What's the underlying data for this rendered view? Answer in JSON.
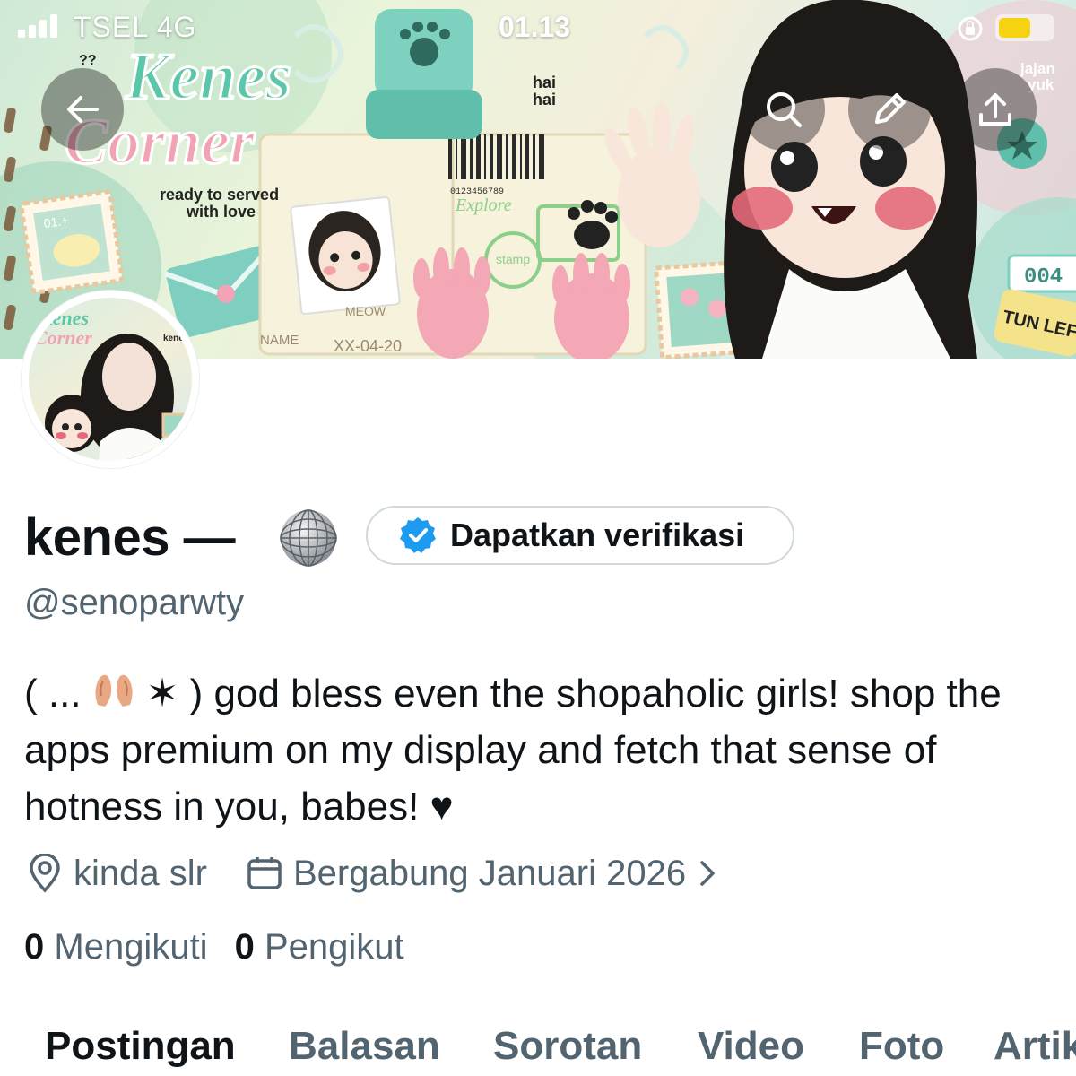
{
  "status_bar": {
    "carrier": "TSEL  4G",
    "time": "01.13",
    "battery_level": 0.6,
    "battery_color": "#f5d313"
  },
  "banner": {
    "texts": {
      "qq": "??",
      "title_line1": "Kenes",
      "title_line2": "Corner",
      "tagline_line1": "ready to served",
      "tagline_line2": "with love",
      "hai": "hai",
      "hai2": "hai",
      "jajan": "jajan",
      "yuk": "yuk",
      "stamp_no": "004",
      "stamp_text": "TUN LEFT",
      "card_num": "01.+",
      "explore": "Explore",
      "stamp": "stamp",
      "name_label": "NAME",
      "date_label": "XX-04-20",
      "meow": "MEOW",
      "barcode_num": "0123456789"
    },
    "buttons": {
      "back": "back-arrow-icon",
      "search": "search-icon",
      "edit": "pencil-icon",
      "share": "share-icon"
    }
  },
  "avatar": {
    "title_line1": "Kenes",
    "title_line2": "Corner",
    "tag": "kenes"
  },
  "profile": {
    "display_name": "kenes —",
    "name_emoji": "disco-ball",
    "verify_button": "Dapatkan verifikasi",
    "handle": "@senoparwty",
    "bio_prefix": "( ...",
    "bio_star": "✶ )",
    "bio_text": "god bless even the shopaholic girls! shop the apps premium on my display and fetch that sense of hotness in you, babes!",
    "bio_heart": "♥",
    "location": "kinda slr",
    "joined": "Bergabung Januari 2026"
  },
  "stats": {
    "following_count": "0",
    "following_label": "Mengikuti",
    "followers_count": "0",
    "followers_label": "Pengikut"
  },
  "tabs": [
    "Postingan",
    "Balasan",
    "Sorotan",
    "Video",
    "Foto",
    "Artik"
  ],
  "colors": {
    "verified_blue": "#1d9bf0",
    "secondary_text": "#536471",
    "primary_text": "#0f1419"
  }
}
